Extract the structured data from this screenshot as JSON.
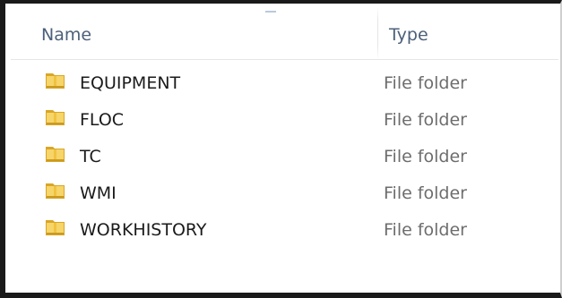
{
  "header": {
    "name_label": "Name",
    "type_label": "Type"
  },
  "rows": [
    {
      "name": "EQUIPMENT",
      "type": "File folder",
      "icon": "folder-icon"
    },
    {
      "name": "FLOC",
      "type": "File folder",
      "icon": "folder-icon"
    },
    {
      "name": "TC",
      "type": "File folder",
      "icon": "folder-icon"
    },
    {
      "name": "WMI",
      "type": "File folder",
      "icon": "folder-icon"
    },
    {
      "name": "WORKHISTORY",
      "type": "File folder",
      "icon": "folder-icon"
    }
  ],
  "colors": {
    "header_text": "#4c607a",
    "name_text": "#1b1b1b",
    "type_text": "#6d6d6d",
    "folder_yellow": "#f2c84b"
  }
}
